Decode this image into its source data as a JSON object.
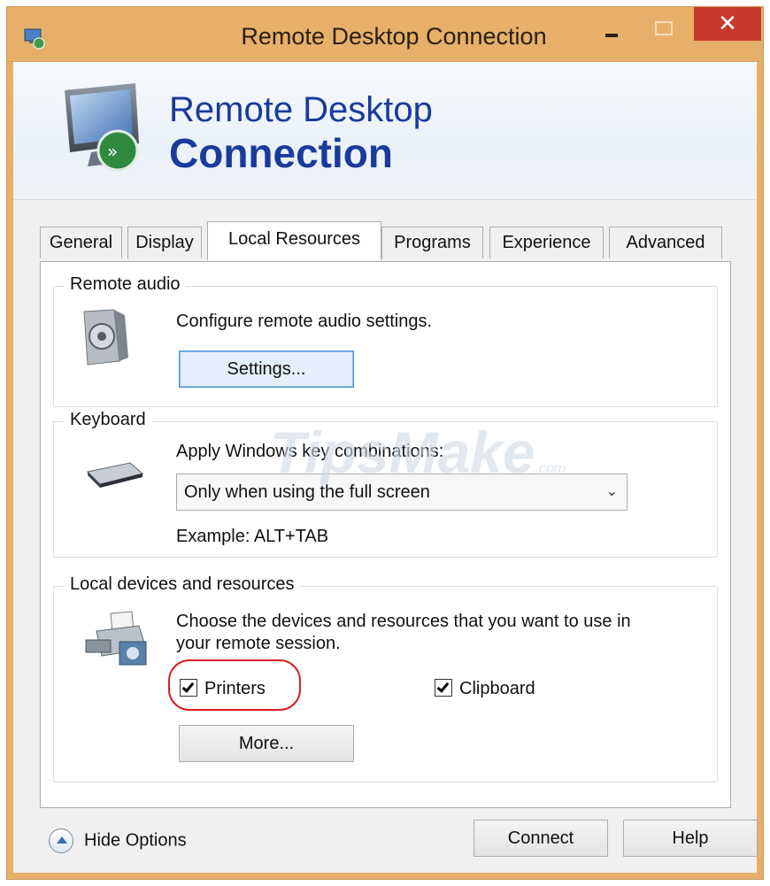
{
  "window": {
    "title": "Remote Desktop Connection"
  },
  "title_buttons": {
    "close": "✕"
  },
  "banner": {
    "line1": "Remote Desktop",
    "line2": "Connection"
  },
  "tabs": [
    "General",
    "Display",
    "Local Resources",
    "Programs",
    "Experience",
    "Advanced"
  ],
  "active_tab": "Local Resources",
  "remote_audio": {
    "group": "Remote audio",
    "description": "Configure remote audio settings.",
    "button": "Settings..."
  },
  "keyboard": {
    "group": "Keyboard",
    "label": "Apply Windows key combinations:",
    "selected": "Only when using the full screen",
    "example": "Example: ALT+TAB"
  },
  "local_devices": {
    "group": "Local devices and resources",
    "description_line1": "Choose the devices and resources that you want to use in",
    "description_line2": "your remote session.",
    "printers": {
      "label": "Printers",
      "checked": true
    },
    "clipboard": {
      "label": "Clipboard",
      "checked": true
    },
    "more_button": "More..."
  },
  "watermark": {
    "text": "TipsMake",
    "suffix": ".com"
  },
  "footer": {
    "hide_options": "Hide Options",
    "connect": "Connect",
    "help": "Help"
  },
  "colors": {
    "titlebar": "#e7b06a",
    "close_button": "#c83a2e",
    "banner_text": "#1a3a9c",
    "highlight_ring": "#d62020"
  }
}
